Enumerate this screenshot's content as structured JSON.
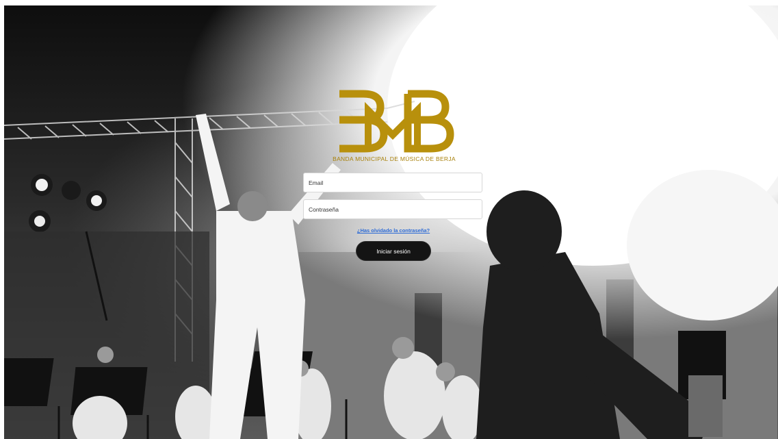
{
  "brand": {
    "logo_letters": "BMB",
    "caption": "BANDA MUNICIPAL DE MÚSICA DE BERJA",
    "gold_color": "#b8900c"
  },
  "background": {
    "description_icon": "concert-photo"
  },
  "login": {
    "email_placeholder": "Email",
    "password_placeholder": "Contraseña",
    "forgot_label": "¿Has olvidado la contraseña?",
    "submit_label": "Iniciar sesión"
  }
}
